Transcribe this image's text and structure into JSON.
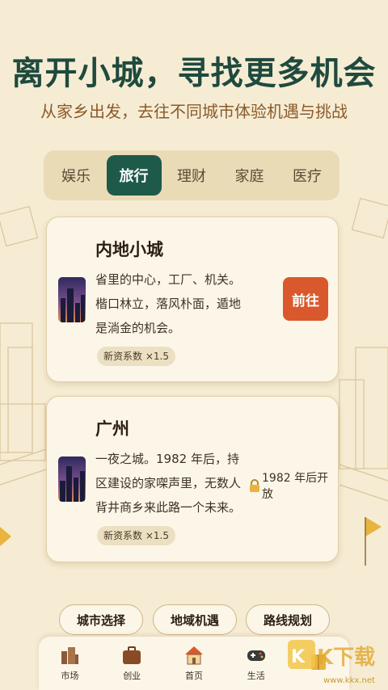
{
  "header": {
    "title": "离开小城，寻找更多机会",
    "subtitle": "从家乡出发，去往不同城市体验机遇与挑战"
  },
  "tabs": [
    {
      "label": "娱乐",
      "active": false
    },
    {
      "label": "旅行",
      "active": true
    },
    {
      "label": "理财",
      "active": false
    },
    {
      "label": "家庭",
      "active": false
    },
    {
      "label": "医疗",
      "active": false
    }
  ],
  "cities": [
    {
      "name": "内地小城",
      "description": "省里的中心，工厂、机关。楷口林立，落风朴面，遁地是淌金的机会。",
      "badge": "新资系数 ×1.5",
      "action": "前往"
    },
    {
      "name": "广州",
      "description": "一夜之城。1982 年后，持区建设的家㗎声里，无数人背井商乡来此路一个未来。",
      "badge": "新资系数 ×1.5",
      "status": "1982 年后开放",
      "status_icon": "lock-icon"
    }
  ],
  "pills": [
    "城市选择",
    "地域机遇",
    "路线规划"
  ],
  "bottom_nav": [
    {
      "label": "市场",
      "icon": "city-icon"
    },
    {
      "label": "创业",
      "icon": "briefcase-icon"
    },
    {
      "label": "首页",
      "icon": "home-icon"
    },
    {
      "label": "生活",
      "icon": "gamepad-icon"
    },
    {
      "label": "",
      "icon": "book-icon"
    }
  ],
  "watermark": {
    "text": "www.kkx.net",
    "logo_text": "KK下载"
  },
  "colors": {
    "background": "#f6ecd4",
    "title": "#1f4a3e",
    "active_tab": "#1e5a4a",
    "action_button": "#d9592c"
  }
}
